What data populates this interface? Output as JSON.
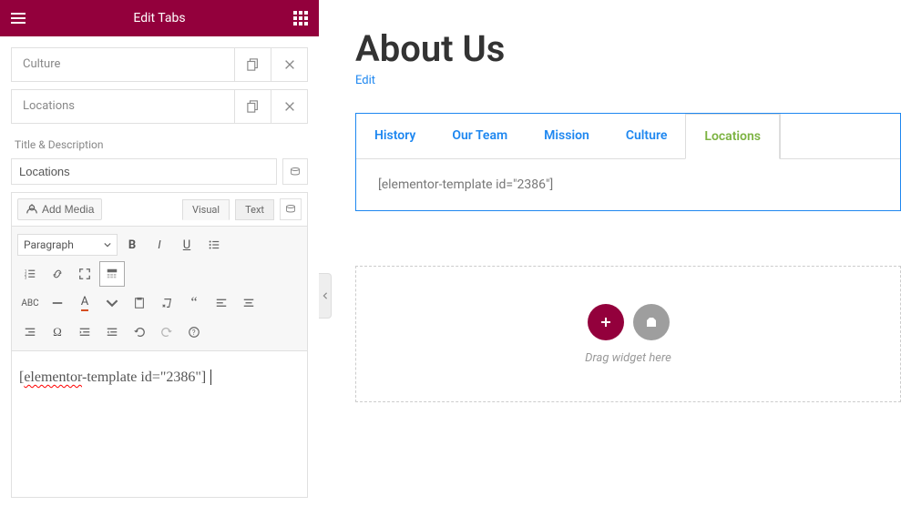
{
  "header": {
    "title": "Edit Tabs"
  },
  "tab_items": [
    {
      "label": "Culture"
    },
    {
      "label": "Locations"
    }
  ],
  "section": {
    "title_desc_label": "Title & Description",
    "title_value": "Locations",
    "add_media_label": "Add Media",
    "visual_tab": "Visual",
    "text_tab": "Text",
    "paragraph_select": "Paragraph",
    "shortcode_word1": "elementor",
    "shortcode_rest": "-template id=\"2386\"]"
  },
  "preview": {
    "page_title": "About Us",
    "edit_link": "Edit",
    "tabs": [
      "History",
      "Our Team",
      "Mission",
      "Culture",
      "Locations"
    ],
    "active_tab_index": 4,
    "tab_content": "[elementor-template id=\"2386\"]",
    "dropzone_text": "Drag widget here"
  }
}
